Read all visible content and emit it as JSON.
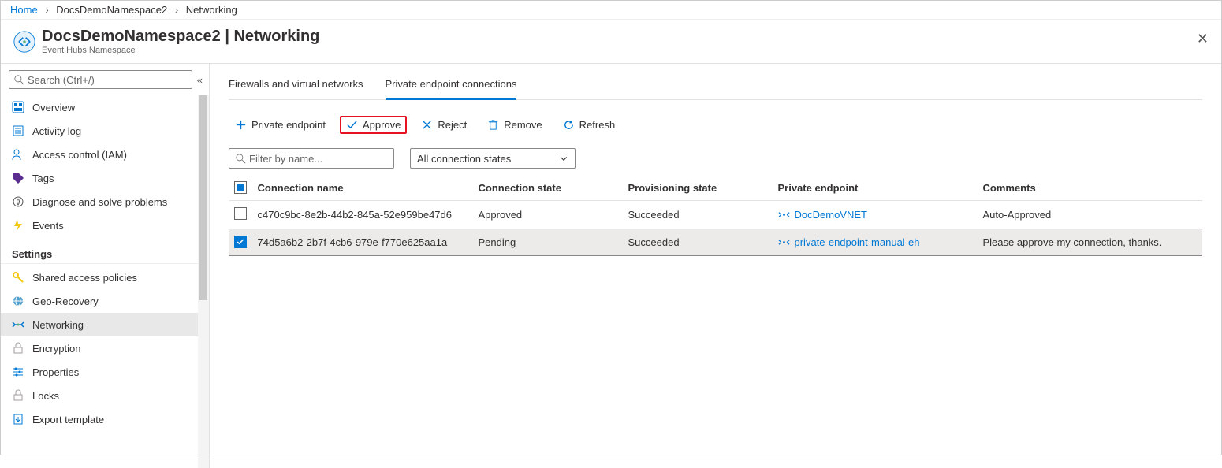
{
  "breadcrumb": {
    "home": "Home",
    "item1": "DocsDemoNamespace2",
    "item2": "Networking"
  },
  "header": {
    "title": "DocsDemoNamespace2 | Networking",
    "subtitle": "Event Hubs Namespace"
  },
  "search": {
    "placeholder": "Search (Ctrl+/)"
  },
  "sidebar": {
    "items": [
      {
        "label": "Overview"
      },
      {
        "label": "Activity log"
      },
      {
        "label": "Access control (IAM)"
      },
      {
        "label": "Tags"
      },
      {
        "label": "Diagnose and solve problems"
      },
      {
        "label": "Events"
      }
    ],
    "section1": "Settings",
    "settings": [
      {
        "label": "Shared access policies"
      },
      {
        "label": "Geo-Recovery"
      },
      {
        "label": "Networking"
      },
      {
        "label": "Encryption"
      },
      {
        "label": "Properties"
      },
      {
        "label": "Locks"
      },
      {
        "label": "Export template"
      }
    ]
  },
  "tabs": {
    "t1": "Firewalls and virtual networks",
    "t2": "Private endpoint connections"
  },
  "toolbar": {
    "private_endpoint": "Private endpoint",
    "approve": "Approve",
    "reject": "Reject",
    "remove": "Remove",
    "refresh": "Refresh"
  },
  "filters": {
    "by_name_placeholder": "Filter by name...",
    "state_label": "All connection states"
  },
  "table": {
    "cols": {
      "c1": "Connection name",
      "c2": "Connection state",
      "c3": "Provisioning state",
      "c4": "Private endpoint",
      "c5": "Comments"
    },
    "rows": [
      {
        "selected": false,
        "name": "c470c9bc-8e2b-44b2-845a-52e959be47d6",
        "conn_state": "Approved",
        "prov_state": "Succeeded",
        "endpoint": "DocDemoVNET",
        "comments": "Auto-Approved"
      },
      {
        "selected": true,
        "name": "74d5a6b2-2b7f-4cb6-979e-f770e625aa1a",
        "conn_state": "Pending",
        "prov_state": "Succeeded",
        "endpoint": "private-endpoint-manual-eh",
        "comments": "Please approve my connection, thanks."
      }
    ]
  }
}
